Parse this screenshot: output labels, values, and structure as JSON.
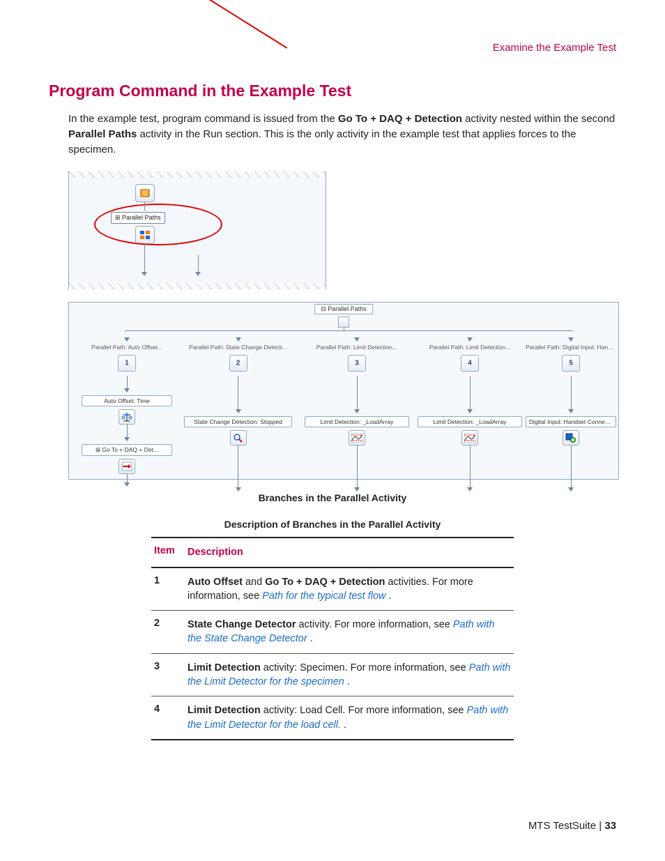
{
  "header": {
    "section": "Examine the Example Test"
  },
  "h1": "Program Command in the Example Test",
  "intro": {
    "t1": "In the example test, program command is issued from the ",
    "b1": "Go To + DAQ + Detection",
    "t2": " activity nested within the second ",
    "b2": "Parallel Paths",
    "t3": " activity in the Run section. This is the only activity in the example test that applies forces to the specimen."
  },
  "fig_upper": {
    "pp_label": "⊞ Parallel Paths"
  },
  "fig_lower": {
    "pp_header": "⊟ Parallel Paths",
    "col1_lbl": "Parallel Path: Auto Offset...",
    "col1_act1": "Auto Offset: Time",
    "col1_act2": "⊞ Go To + DAQ + Det...",
    "col2_lbl": "Parallel Path: State Change Detecti...",
    "col2_act": "State Change Detection: Stopped",
    "col3_lbl": "Parallel Path: Limit Detection...",
    "col3_act": "Limit Detection: _LoadArray",
    "col4_lbl": "Parallel Path: Limit Detection...",
    "col4_act": "Limit Detection: _LoadArray",
    "col5_lbl": "Parallel Path: Digital Input: Handset C...",
    "col5_act": "Digital Input: Handset Connected..."
  },
  "caption1": "Branches in the Parallel Activity",
  "caption2": "Description of Branches in the Parallel Activity",
  "table": {
    "head_item": "Item",
    "head_desc": "Description",
    "rows": [
      {
        "num": "1",
        "b1": "Auto Offset",
        "t1": " and ",
        "b2": "Go To + DAQ + Detection",
        "t2": " activities. For more information, see ",
        "link": "Path for the typical test flow",
        "t3": "  ."
      },
      {
        "num": "2",
        "b1": "State Change Detector",
        "t1": " activity. For more information, see ",
        "link": "Path with the State Change Detector",
        "t3": "  ."
      },
      {
        "num": "3",
        "b1": "Limit Detection",
        "t1": " activity: Specimen. For more information, see ",
        "link": "Path with the Limit Detector for the specimen",
        "t3": "  ."
      },
      {
        "num": "4",
        "b1": "Limit Detection",
        "t1": " activity: Load Cell. For more information, see ",
        "link": "Path with the Limit Detector for the load cell.",
        "t3": "  ."
      }
    ]
  },
  "footer": {
    "product": "MTS TestSuite",
    "sep": " | ",
    "page": "33"
  }
}
